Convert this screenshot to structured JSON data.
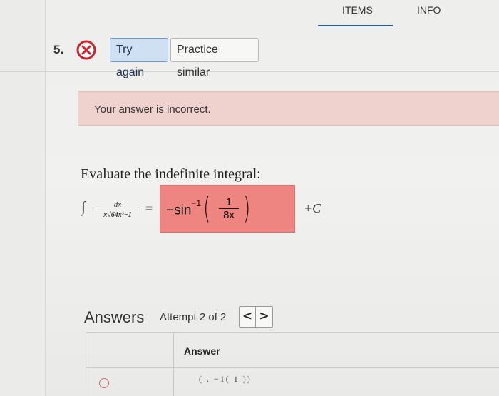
{
  "top_tabs": [
    {
      "label": "ITEMS",
      "active": true
    },
    {
      "label": "INFO",
      "active": false
    }
  ],
  "question": {
    "number": "5.",
    "status_icon": "incorrect-x-icon",
    "try_again_label": "Try again",
    "practice_similar_label": "Practice similar"
  },
  "feedback": {
    "message": "Your answer is incorrect."
  },
  "problem": {
    "prompt": "Evaluate the indefinite integral:",
    "integral_sign": "∫",
    "integrand_numerator": "dx",
    "integrand_denominator": "x√64x²−1",
    "equals": "=",
    "constant": "+C"
  },
  "submitted_answer": {
    "function": "−sin",
    "exponent": "−1",
    "fraction_numerator": "1",
    "fraction_denominator": "8x",
    "left_paren": "(",
    "right_paren": ")"
  },
  "answers_section": {
    "title": "Answers",
    "attempt_text": "Attempt 2 of 2",
    "prev_symbol": "<",
    "next_symbol": ">",
    "column_header": "Answer",
    "partial_row_text": "( . −1( 1 ))"
  },
  "colors": {
    "incorrect_banner": "#efd1cd",
    "wrong_answer_fill": "#ee8580",
    "incorrect_icon": "#d2232a",
    "try_again_bg": "#cfe0f3",
    "active_tab_underline": "#2c5d92"
  }
}
